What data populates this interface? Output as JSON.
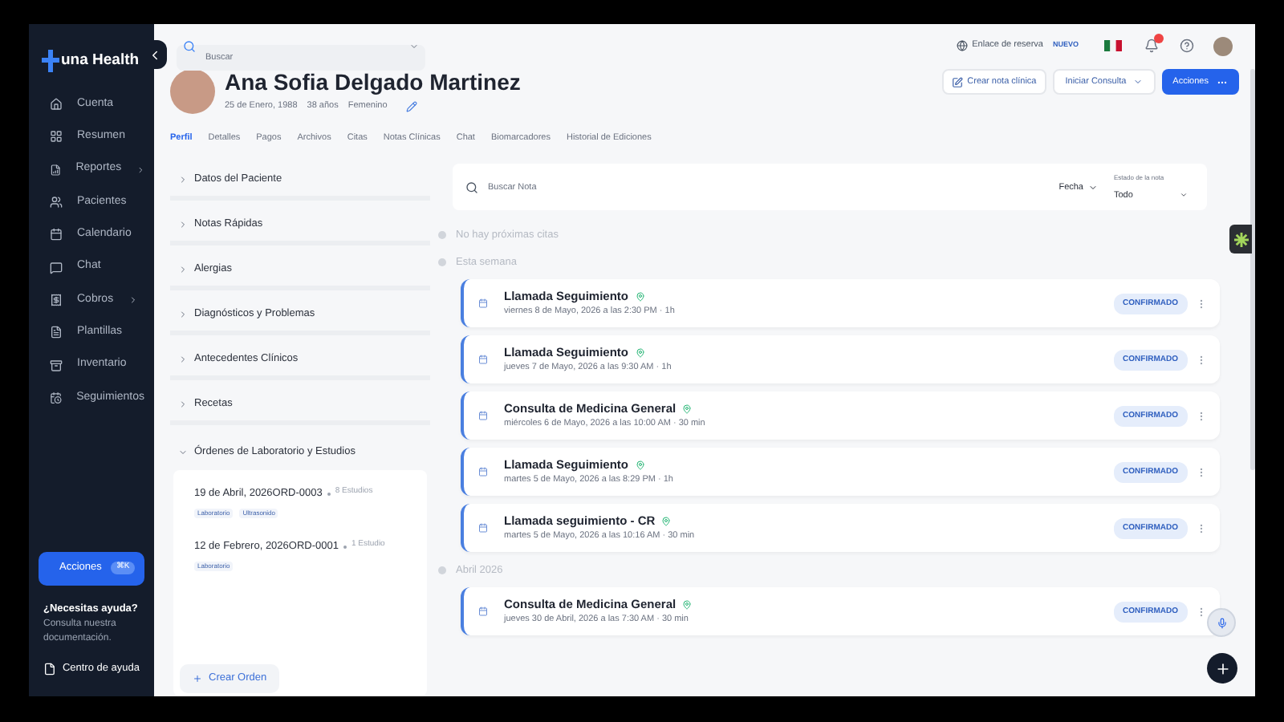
{
  "sidebar": {
    "logo": "una Health",
    "items": [
      {
        "label": "Cuenta",
        "has_submenu": false
      },
      {
        "label": "Resumen",
        "has_submenu": false
      },
      {
        "label": "Reportes",
        "has_submenu": true
      },
      {
        "label": "Pacientes",
        "has_submenu": false
      },
      {
        "label": "Calendario",
        "has_submenu": false
      },
      {
        "label": "Chat",
        "has_submenu": false
      },
      {
        "label": "Cobros",
        "has_submenu": true
      },
      {
        "label": "Plantillas",
        "has_submenu": false
      },
      {
        "label": "Inventario",
        "has_submenu": false
      },
      {
        "label": "Seguimientos",
        "has_submenu": false
      }
    ],
    "actions_button": {
      "label": "Acciones",
      "shortcut": "⌘K"
    },
    "help": {
      "title": "¿Necesitas ayuda?",
      "text": "Consulta nuestra documentación.",
      "link": "Centro de ayuda"
    }
  },
  "topbar": {
    "search": {
      "placeholder": "Buscar"
    },
    "booking_link": "Enlace de reserva",
    "booking_badge": "NUEVO",
    "notifications": true
  },
  "patient": {
    "name": "Ana Sofia Delgado Martinez",
    "birthdate": "25 de Enero, 1988",
    "age": "38 años",
    "sex": "Femenino"
  },
  "header_buttons": {
    "note": "Crear nota clínica",
    "consult": "Iniciar Consulta",
    "actions": "Acciones"
  },
  "tabs": [
    {
      "label": "Perfil",
      "selected": true
    },
    {
      "label": "Detalles",
      "selected": false
    },
    {
      "label": "Pagos",
      "selected": false
    },
    {
      "label": "Archivos",
      "selected": false
    },
    {
      "label": "Citas",
      "selected": false
    },
    {
      "label": "Notas Clínicas",
      "selected": false
    },
    {
      "label": "Chat",
      "selected": false
    },
    {
      "label": "Biomarcadores",
      "selected": false
    },
    {
      "label": "Historial de Ediciones",
      "selected": false
    }
  ],
  "sections": [
    {
      "label": "Datos del Paciente",
      "expanded": false
    },
    {
      "label": "Notas Rápidas",
      "expanded": false
    },
    {
      "label": "Alergias",
      "expanded": false
    },
    {
      "label": "Diagnósticos y Problemas",
      "expanded": false
    },
    {
      "label": "Antecedentes Clínicos",
      "expanded": false
    },
    {
      "label": "Recetas",
      "expanded": false
    },
    {
      "label": "Órdenes de Laboratorio y Estudios",
      "expanded": true
    }
  ],
  "lab_orders": [
    {
      "title": "19 de Abril, 2026ORD-0003",
      "count": "8 Estudios",
      "tags": [
        "Laboratorio",
        "Ultrasonido"
      ]
    },
    {
      "title": "12 de Febrero, 2026ORD-0001",
      "count": "1 Estudio",
      "tags": [
        "Laboratorio"
      ]
    }
  ],
  "create_order": "Crear Orden",
  "notes_filter": {
    "search_placeholder": "Buscar Nota",
    "date_sort": "Fecha",
    "status_label": "Estado de la nota",
    "status_value": "Todo"
  },
  "timeline": [
    {
      "label": "No hay próximas citas"
    },
    {
      "label": "Esta semana",
      "appointments": [
        {
          "title": "Llamada Seguimiento",
          "when": "viernes 8 de Mayo, 2026 a las 2:30 PM · 1h",
          "status": "CONFIRMADO"
        },
        {
          "title": "Llamada Seguimiento",
          "when": "jueves 7 de Mayo, 2026 a las 9:30 AM · 1h",
          "status": "CONFIRMADO"
        },
        {
          "title": "Consulta de Medicina General",
          "when": "miércoles 6 de Mayo, 2026 a las 10:00 AM · 30 min",
          "status": "CONFIRMADO"
        },
        {
          "title": "Llamada Seguimiento",
          "when": "martes 5 de Mayo, 2026 a las 8:29 PM · 1h",
          "status": "CONFIRMADO"
        },
        {
          "title": "Llamada seguimiento - CR",
          "when": "martes 5 de Mayo, 2026 a las 10:16 AM · 30 min",
          "status": "CONFIRMADO"
        }
      ]
    },
    {
      "label": "Abril 2026",
      "appointments": [
        {
          "title": "Consulta de Medicina General",
          "when": "jueves 30 de Abril, 2026 a las 7:30 AM · 30 min",
          "status": "CONFIRMADO"
        }
      ]
    }
  ]
}
